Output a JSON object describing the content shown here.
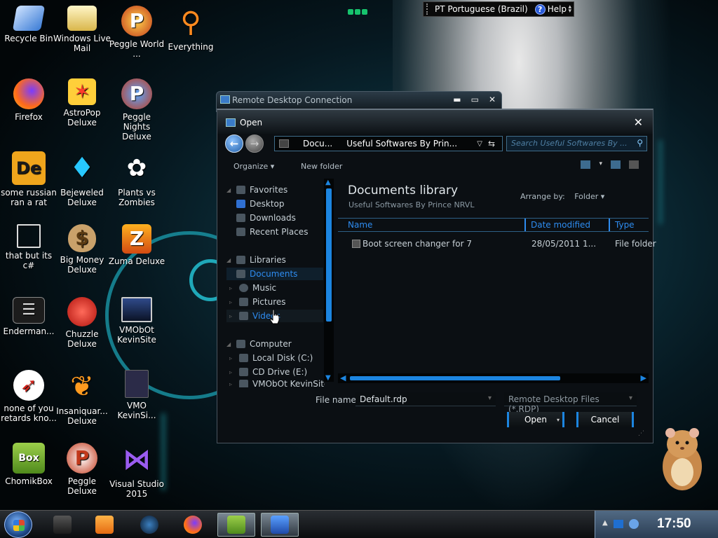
{
  "language_bar": {
    "language": "PT Portuguese (Brazil)",
    "help": "Help"
  },
  "desktop_icons": [
    {
      "label": "Recycle Bin",
      "icon": "recycle-bin-icon"
    },
    {
      "label": "Windows Live Mail",
      "icon": "mail-icon"
    },
    {
      "label": "Peggle World ...",
      "icon": "peggle-icon"
    },
    {
      "label": "Everything",
      "icon": "magnifier-icon"
    },
    {
      "label": "Firefox",
      "icon": "firefox-icon"
    },
    {
      "label": "AstroPop Deluxe",
      "icon": "astropop-icon"
    },
    {
      "label": "Peggle Nights Deluxe",
      "icon": "peggle-icon"
    },
    {
      "label": "some russian ran a rat",
      "icon": "de-icon"
    },
    {
      "label": "Bejeweled Deluxe",
      "icon": "gem-icon"
    },
    {
      "label": "Plants vs Zombies",
      "icon": "plant-icon"
    },
    {
      "label": "that but its c#",
      "icon": "copy-icon"
    },
    {
      "label": "Big Money Deluxe",
      "icon": "money-bag-icon"
    },
    {
      "label": "Zuma Deluxe",
      "icon": "zuma-icon"
    },
    {
      "label": "Enderman...",
      "icon": "list-icon"
    },
    {
      "label": "Chuzzle Deluxe",
      "icon": "chuzzle-icon"
    },
    {
      "label": "VMObOt KevinSite",
      "icon": "monitor-icon"
    },
    {
      "label": "none of you retards kno...",
      "icon": "dragon-icon"
    },
    {
      "label": "Insaniquar... Deluxe",
      "icon": "fish-icon"
    },
    {
      "label": "VMO KevinSi...",
      "icon": "firefox-file-icon"
    },
    {
      "label": "ChomikBox",
      "icon": "chomikbox-icon"
    },
    {
      "label": "Peggle Deluxe",
      "icon": "peggle-icon"
    },
    {
      "label": "Visual Studio 2015",
      "icon": "visual-studio-icon"
    }
  ],
  "rdc_window": {
    "title": "Remote Desktop Connection"
  },
  "dialog": {
    "title": "Open",
    "address": {
      "seg1": "Docu...",
      "seg2": "Useful Softwares By Prin..."
    },
    "search_placeholder": "Search Useful Softwares By ...",
    "toolbar": {
      "organize": "Organize",
      "new_folder": "New folder"
    },
    "nav": {
      "favorites": "Favorites",
      "desktop": "Desktop",
      "downloads": "Downloads",
      "recent_places": "Recent Places",
      "libraries": "Libraries",
      "documents": "Documents",
      "music": "Music",
      "pictures": "Pictures",
      "videos": "Videos",
      "computer": "Computer",
      "local_disk": "Local Disk (C:)",
      "cd_drive": "CD Drive (E:)",
      "cut_item": "VMObOt KevinSite"
    },
    "library": {
      "title": "Documents library",
      "subtitle": "Useful Softwares By Prince NRVL",
      "arrange_by_label": "Arrange by:",
      "arrange_by_value": "Folder"
    },
    "columns": {
      "name": "Name",
      "date": "Date modified",
      "type": "Type"
    },
    "rows": [
      {
        "name": "Boot screen changer for 7",
        "date": "28/05/2011 1...",
        "type": "File folder"
      }
    ],
    "file_name_label": "File name:",
    "file_name_value": "Default.rdp",
    "file_type_value": "Remote Desktop Files (*.RDP)",
    "open_button": "Open",
    "cancel_button": "Cancel"
  },
  "clock": "17:50"
}
